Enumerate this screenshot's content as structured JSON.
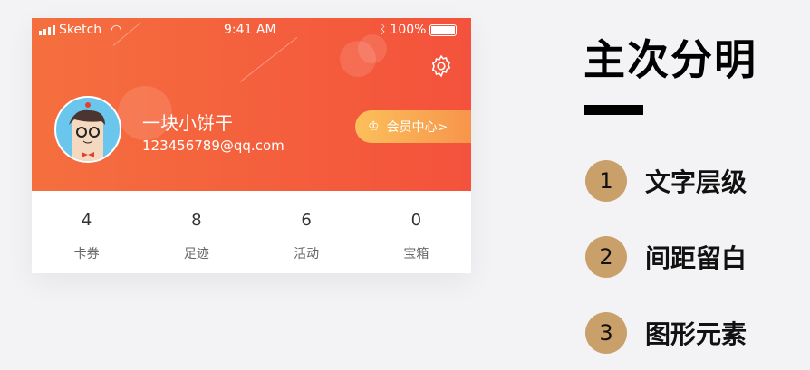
{
  "status_bar": {
    "carrier": "Sketch",
    "time": "9:41 AM",
    "battery": "100%"
  },
  "profile": {
    "name": "一块小饼干",
    "email": "123456789@qq.com",
    "vip_label": "会员中心>"
  },
  "stats": [
    {
      "value": "4",
      "label": "卡券"
    },
    {
      "value": "8",
      "label": "足迹"
    },
    {
      "value": "6",
      "label": "活动"
    },
    {
      "value": "0",
      "label": "宝箱"
    }
  ],
  "slide": {
    "title": "主次分明",
    "points": [
      {
        "num": "1",
        "text": "文字层级"
      },
      {
        "num": "2",
        "text": "间距留白"
      },
      {
        "num": "3",
        "text": "图形元素"
      }
    ]
  },
  "colors": {
    "header_start": "#f56f3e",
    "header_end": "#f4523c",
    "gold": "#c9a06a"
  }
}
